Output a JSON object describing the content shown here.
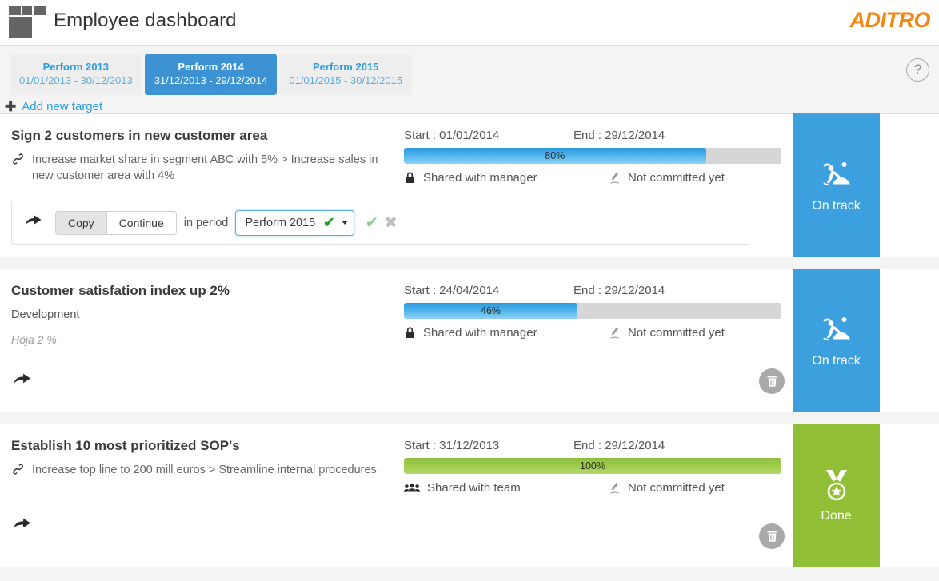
{
  "header": {
    "title": "Employee dashboard",
    "brand": "ADITRO",
    "logo_icon": "grid-blocks-logo",
    "help_icon": "question-mark-icon",
    "help_label": "?"
  },
  "tabs": [
    {
      "name": "Perform 2013",
      "range": "01/01/2013 - 30/12/2013",
      "active": false
    },
    {
      "name": "Perform 2014",
      "range": "31/12/2013 - 29/12/2014",
      "active": true
    },
    {
      "name": "Perform 2015",
      "range": "01/01/2015 - 30/12/2015",
      "active": false
    }
  ],
  "add_target": {
    "icon": "plus-icon",
    "label": "Add new target"
  },
  "labels": {
    "start_prefix": "Start : ",
    "end_prefix": "End : ",
    "trash_icon": "trash-icon",
    "share_icon": "share-arrow-icon",
    "link_icon": "chain-link-icon",
    "lock_icon": "lock-icon",
    "team_icon": "team-icon",
    "commit_icon": "signature-pen-icon"
  },
  "action_bar": {
    "share_icon": "share-arrow-icon",
    "copy_label": "Copy",
    "continue_label": "Continue",
    "in_period_label": "in period",
    "selected_period": "Perform 2015",
    "select_tick": "✔",
    "confirm_icon": "check-icon",
    "confirm_glyph": "✔",
    "cancel_icon": "cross-icon",
    "cancel_glyph": "✖"
  },
  "colors": {
    "accent_blue": "#3ca0de",
    "accent_green": "#91bf36",
    "brand_orange": "#f5860f",
    "tab_active": "#3d92d3",
    "progress_track": "#d6d6d6"
  },
  "cards": [
    {
      "title": "Sign 2 customers in new customer area",
      "subtitle": "Increase market share in segment ABC with 5% > Increase sales in new customer area with 4%",
      "subtitle_type": "link",
      "start": "01/01/2014",
      "end": "29/12/2014",
      "progress": 80,
      "progress_label": "80%",
      "progress_color": "blue",
      "share_text": "Shared with manager",
      "share_icon": "lock-icon",
      "commit_text": "Not committed yet",
      "status": "On track",
      "status_color": "blue",
      "status_icon": "worker-digging-icon",
      "has_action_bar": true
    },
    {
      "title": "Customer satisfation index up 2%",
      "subtitle": "Development",
      "subtitle_type": "plain",
      "note": "Höja 2 %",
      "start": "24/04/2014",
      "end": "29/12/2014",
      "progress": 46,
      "progress_label": "46%",
      "progress_color": "blue",
      "share_text": "Shared with manager",
      "share_icon": "lock-icon",
      "commit_text": "Not committed yet",
      "status": "On track",
      "status_color": "blue",
      "status_icon": "worker-digging-icon",
      "has_action_bar": false
    },
    {
      "title": "Establish 10 most prioritized SOP's",
      "subtitle": "Increase top line to 200 mill euros > Streamline internal procedures",
      "subtitle_type": "link",
      "start": "31/12/2013",
      "end": "29/12/2014",
      "progress": 100,
      "progress_label": "100%",
      "progress_color": "green",
      "share_text": "Shared with team",
      "share_icon": "team-icon",
      "commit_text": "Not committed yet",
      "status": "Done",
      "status_color": "green",
      "status_icon": "medal-icon",
      "has_action_bar": false
    }
  ]
}
